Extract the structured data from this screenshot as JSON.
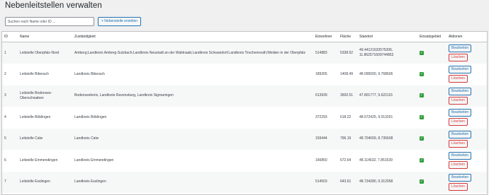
{
  "page": {
    "title": "Nebenleitstellen verwalten"
  },
  "toolbar": {
    "search_placeholder": "Suchen nach Name oder ID ...",
    "add_label": "+ Nebenstelle erstellen"
  },
  "table": {
    "headers": [
      "ID",
      "Name",
      "Zuständigkeit",
      "Einwohner",
      "Fläche",
      "Standort",
      "Einsatzgebiet",
      "Aktionen"
    ],
    "edit_label": "Bearbeiten",
    "delete_label": "Löschen",
    "rows": [
      {
        "id": "1",
        "name": "Leitstelle Oberpfalz-Nord",
        "zust": "Amberg;Landkreis Amberg-Sulzbach;Landkreis Neustadt an der Waldnaab;Landkreis Schwandorf;Landkreis Tirschenreuth;Weiden in der Oberpfalz",
        "einwohner": "514883",
        "flaeche": "5338.52",
        "standort": "49.44121633575306, 11.862571609744853",
        "einsatzgebiet": true
      },
      {
        "id": "2",
        "name": "Leitstelle Biberach",
        "zust": "Landkreis Biberach",
        "einwohner": "189265",
        "flaeche": "1408.49",
        "standort": "48.095000, 9.768606",
        "einsatzgebiet": true
      },
      {
        "id": "3",
        "name": "Leitstelle Bodensee-Oberschwaben",
        "zust": "Bodenseekreis, Landkreis Ravensburg, Landkreis Sigmaringen",
        "einwohner": "613939",
        "flaeche": "3500.51",
        "standort": "47.801777, 9.622101",
        "einsatzgebiet": true
      },
      {
        "id": "4",
        "name": "Leitstelle Böblingen",
        "zust": "Landkreis Böblingen",
        "einwohner": "372293",
        "flaeche": "618.22",
        "standort": "48.672425, 9.013261",
        "einsatzgebiet": true
      },
      {
        "id": "5",
        "name": "Leitstelle Calw",
        "zust": "Landkreis Calw",
        "einwohner": "159444",
        "flaeche": "796.19",
        "standort": "48.704009, 8.735608",
        "einsatzgebiet": true
      },
      {
        "id": "6",
        "name": "Leitstelle Emmendingen",
        "zust": "Landkreis Emmendingen",
        "einwohner": "166850",
        "flaeche": "672.64",
        "standort": "48.114632, 7.851539",
        "einsatzgebiet": true
      },
      {
        "id": "7",
        "name": "Leitstelle Esslingen",
        "zust": "Landkreis Esslingen",
        "einwohner": "514503",
        "flaeche": "643.61",
        "standort": "48.734280, 9.312958",
        "einsatzgebiet": true
      }
    ]
  }
}
